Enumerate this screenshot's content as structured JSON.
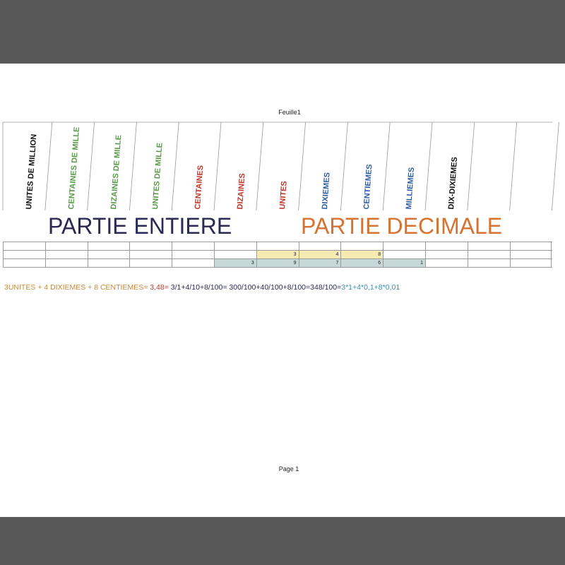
{
  "sheet_title": "Feuille1",
  "page_footer": "Page 1",
  "columns": [
    {
      "label": "UNITES DE MILLION",
      "color": "#111111"
    },
    {
      "label": "CENTAINES DE MILLE",
      "color": "#5a9a4a"
    },
    {
      "label": "DIZAINES DE MILLE",
      "color": "#5a9a4a"
    },
    {
      "label": "UNITES DE MILLE",
      "color": "#5a9a4a"
    },
    {
      "label": "CENTAINES",
      "color": "#c0392b"
    },
    {
      "label": "DIZAINES",
      "color": "#c0392b"
    },
    {
      "label": "UNITES",
      "color": "#c0392b"
    },
    {
      "label": "DIXIEMES",
      "color": "#2e5fa5"
    },
    {
      "label": "CENTIEMES",
      "color": "#2e5fa5"
    },
    {
      "label": "MILLIEMES",
      "color": "#2e5fa5"
    },
    {
      "label": "DIX-DIXIEMES",
      "color": "#111111"
    },
    {
      "label": "",
      "color": "#111111"
    },
    {
      "label": "",
      "color": "#111111"
    }
  ],
  "parts": {
    "entiere": "PARTIE ENTIERE",
    "decimale": "PARTIE DECIMALE"
  },
  "rows": [
    {
      "cells": [
        "",
        "",
        "",
        "",
        "",
        "",
        "3",
        "4",
        "8",
        "",
        "",
        "",
        ""
      ],
      "highlight": [
        "",
        "",
        "",
        "",
        "",
        "",
        "yellow",
        "yellow",
        "yellow",
        "",
        "",
        "",
        ""
      ]
    },
    {
      "cells": [
        "",
        "",
        "",
        "",
        "",
        "3",
        "9",
        "7",
        "6",
        "1",
        "",
        "",
        ""
      ],
      "highlight": [
        "",
        "",
        "",
        "",
        "",
        "teal",
        "teal",
        "teal",
        "teal",
        "teal",
        "",
        "",
        ""
      ]
    }
  ],
  "formula": [
    {
      "text": "3UNITES + 4 DIXIEMES + 8 CENTIEMES= ",
      "color": "#c8893a"
    },
    {
      "text": "3,48",
      "color": "#c0392b"
    },
    {
      "text": "= ",
      "color": "#c0392b"
    },
    {
      "text": "3/1+4/10+8/100",
      "color": "#2a2a55"
    },
    {
      "text": "= 300/100+40/100+8/100=348/100=",
      "color": "#2a2a55"
    },
    {
      "text": "3*1+4*0,1+8*0,01",
      "color": "#3a8fb0"
    }
  ]
}
